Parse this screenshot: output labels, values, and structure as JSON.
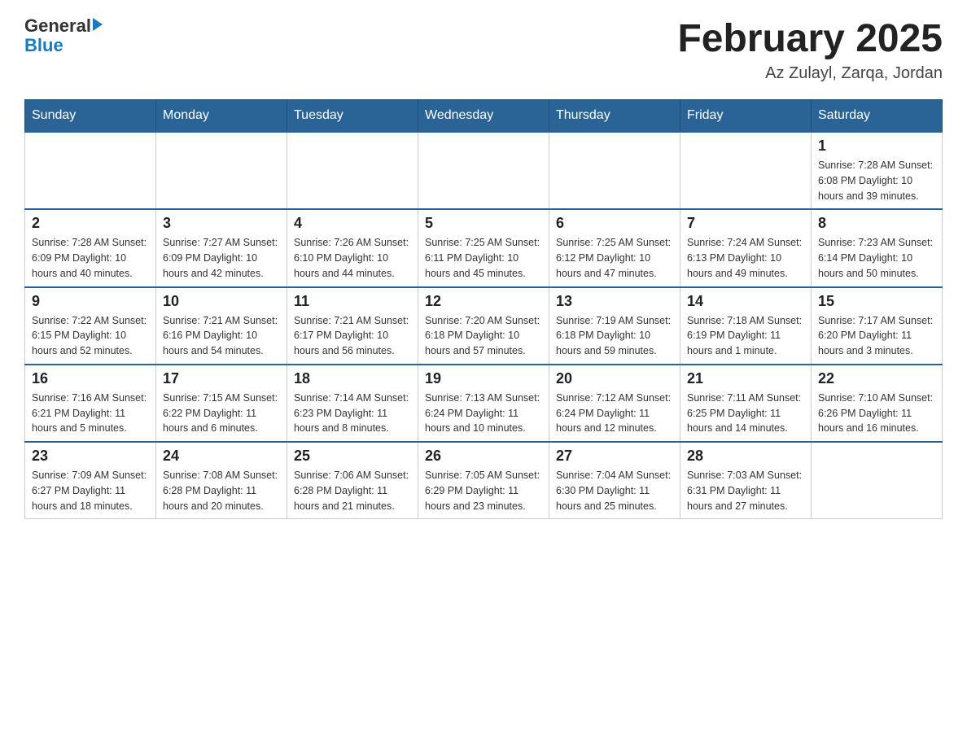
{
  "header": {
    "logo_general": "General",
    "logo_blue": "Blue",
    "title": "February 2025",
    "subtitle": "Az Zulayl, Zarqa, Jordan"
  },
  "days_of_week": [
    "Sunday",
    "Monday",
    "Tuesday",
    "Wednesday",
    "Thursday",
    "Friday",
    "Saturday"
  ],
  "weeks": [
    [
      {
        "day": "",
        "info": ""
      },
      {
        "day": "",
        "info": ""
      },
      {
        "day": "",
        "info": ""
      },
      {
        "day": "",
        "info": ""
      },
      {
        "day": "",
        "info": ""
      },
      {
        "day": "",
        "info": ""
      },
      {
        "day": "1",
        "info": "Sunrise: 7:28 AM\nSunset: 6:08 PM\nDaylight: 10 hours and 39 minutes."
      }
    ],
    [
      {
        "day": "2",
        "info": "Sunrise: 7:28 AM\nSunset: 6:09 PM\nDaylight: 10 hours and 40 minutes."
      },
      {
        "day": "3",
        "info": "Sunrise: 7:27 AM\nSunset: 6:09 PM\nDaylight: 10 hours and 42 minutes."
      },
      {
        "day": "4",
        "info": "Sunrise: 7:26 AM\nSunset: 6:10 PM\nDaylight: 10 hours and 44 minutes."
      },
      {
        "day": "5",
        "info": "Sunrise: 7:25 AM\nSunset: 6:11 PM\nDaylight: 10 hours and 45 minutes."
      },
      {
        "day": "6",
        "info": "Sunrise: 7:25 AM\nSunset: 6:12 PM\nDaylight: 10 hours and 47 minutes."
      },
      {
        "day": "7",
        "info": "Sunrise: 7:24 AM\nSunset: 6:13 PM\nDaylight: 10 hours and 49 minutes."
      },
      {
        "day": "8",
        "info": "Sunrise: 7:23 AM\nSunset: 6:14 PM\nDaylight: 10 hours and 50 minutes."
      }
    ],
    [
      {
        "day": "9",
        "info": "Sunrise: 7:22 AM\nSunset: 6:15 PM\nDaylight: 10 hours and 52 minutes."
      },
      {
        "day": "10",
        "info": "Sunrise: 7:21 AM\nSunset: 6:16 PM\nDaylight: 10 hours and 54 minutes."
      },
      {
        "day": "11",
        "info": "Sunrise: 7:21 AM\nSunset: 6:17 PM\nDaylight: 10 hours and 56 minutes."
      },
      {
        "day": "12",
        "info": "Sunrise: 7:20 AM\nSunset: 6:18 PM\nDaylight: 10 hours and 57 minutes."
      },
      {
        "day": "13",
        "info": "Sunrise: 7:19 AM\nSunset: 6:18 PM\nDaylight: 10 hours and 59 minutes."
      },
      {
        "day": "14",
        "info": "Sunrise: 7:18 AM\nSunset: 6:19 PM\nDaylight: 11 hours and 1 minute."
      },
      {
        "day": "15",
        "info": "Sunrise: 7:17 AM\nSunset: 6:20 PM\nDaylight: 11 hours and 3 minutes."
      }
    ],
    [
      {
        "day": "16",
        "info": "Sunrise: 7:16 AM\nSunset: 6:21 PM\nDaylight: 11 hours and 5 minutes."
      },
      {
        "day": "17",
        "info": "Sunrise: 7:15 AM\nSunset: 6:22 PM\nDaylight: 11 hours and 6 minutes."
      },
      {
        "day": "18",
        "info": "Sunrise: 7:14 AM\nSunset: 6:23 PM\nDaylight: 11 hours and 8 minutes."
      },
      {
        "day": "19",
        "info": "Sunrise: 7:13 AM\nSunset: 6:24 PM\nDaylight: 11 hours and 10 minutes."
      },
      {
        "day": "20",
        "info": "Sunrise: 7:12 AM\nSunset: 6:24 PM\nDaylight: 11 hours and 12 minutes."
      },
      {
        "day": "21",
        "info": "Sunrise: 7:11 AM\nSunset: 6:25 PM\nDaylight: 11 hours and 14 minutes."
      },
      {
        "day": "22",
        "info": "Sunrise: 7:10 AM\nSunset: 6:26 PM\nDaylight: 11 hours and 16 minutes."
      }
    ],
    [
      {
        "day": "23",
        "info": "Sunrise: 7:09 AM\nSunset: 6:27 PM\nDaylight: 11 hours and 18 minutes."
      },
      {
        "day": "24",
        "info": "Sunrise: 7:08 AM\nSunset: 6:28 PM\nDaylight: 11 hours and 20 minutes."
      },
      {
        "day": "25",
        "info": "Sunrise: 7:06 AM\nSunset: 6:28 PM\nDaylight: 11 hours and 21 minutes."
      },
      {
        "day": "26",
        "info": "Sunrise: 7:05 AM\nSunset: 6:29 PM\nDaylight: 11 hours and 23 minutes."
      },
      {
        "day": "27",
        "info": "Sunrise: 7:04 AM\nSunset: 6:30 PM\nDaylight: 11 hours and 25 minutes."
      },
      {
        "day": "28",
        "info": "Sunrise: 7:03 AM\nSunset: 6:31 PM\nDaylight: 11 hours and 27 minutes."
      },
      {
        "day": "",
        "info": ""
      }
    ]
  ]
}
